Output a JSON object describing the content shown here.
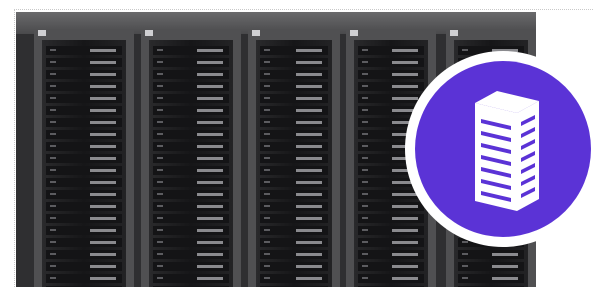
{
  "colors": {
    "accent": "#5b33d6",
    "rack_dark": "#1b1b1d",
    "rack_frame": "#4a4a4c",
    "ceiling": "#58585a",
    "badge_ring": "#ffffff"
  },
  "image": {
    "subject": "server-racks-photo",
    "badge_icon": "server-rack-icon"
  }
}
